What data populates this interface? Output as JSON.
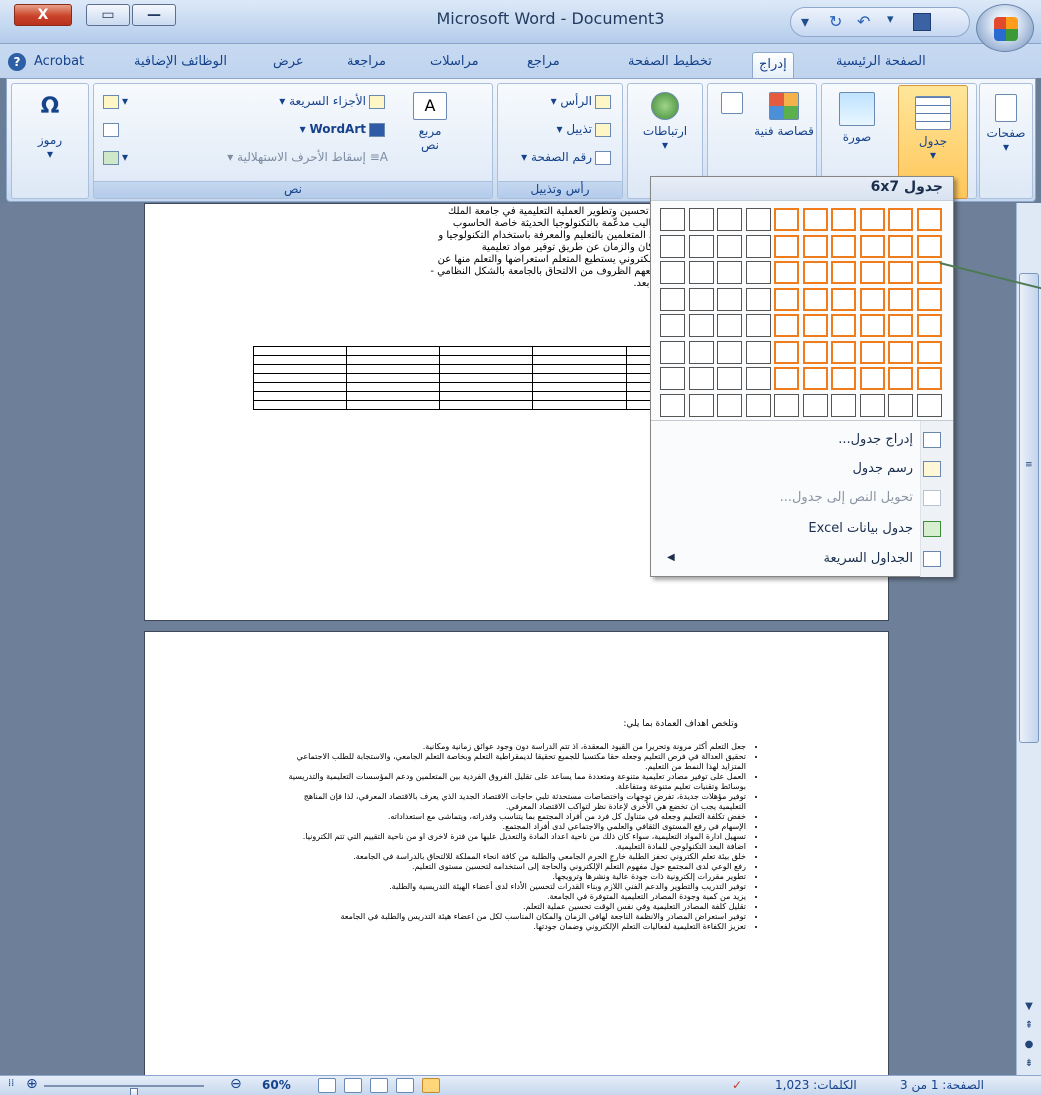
{
  "title_bar": {
    "title": "Microsoft Word - Document3",
    "close_label": "X",
    "restore_label": "▭",
    "minimize_label": "—",
    "qat_icons": [
      "save-icon",
      "redo-icon",
      "undo-icon",
      "customize-icon"
    ]
  },
  "tabs": {
    "help": "?",
    "items": [
      "Acrobat",
      "الوظائف الإضافية",
      "عرض",
      "مراجعة",
      "مراسلات",
      "مراجع",
      "تخطيط الصفحة",
      "إدراج",
      "الصفحة الرئيسية"
    ],
    "active": "إدراج"
  },
  "ribbon": {
    "pages": "صفحات",
    "table": "جدول",
    "picture": "صورة",
    "clipart": "قصاصة فنية",
    "links": "ارتباطات",
    "header": "الرأس",
    "footer": "تذييل",
    "page_number": "رقم الصفحة",
    "header_footer_group": "رأس وتذييل",
    "quick_parts": "الأجزاء السريعة",
    "wordart": "WordArt",
    "dropcap": "إسقاط الأحرف الاستهلالية",
    "textbox": "مربع نص",
    "text_group": "نص",
    "symbols": "رموز",
    "omega": "Ω"
  },
  "dropdown": {
    "header": "6x7 جدول",
    "grid_cols": 10,
    "grid_rows": 8,
    "hl_cols": 6,
    "hl_rows": 7,
    "items": [
      {
        "label": "إدراج جدول...",
        "disabled": false
      },
      {
        "label": "رسم جدول",
        "disabled": false
      },
      {
        "label": "تحويل النص إلى جدول...",
        "disabled": true
      },
      {
        "label": "جدول بيانات Excel",
        "disabled": false
      },
      {
        "label": "الجداول السريعة",
        "disabled": false
      }
    ]
  },
  "page1": {
    "lines": [
      "...كتروني الى تحسين وتطوير العملية التعليمية في جامعة الملك",
      "...تيجيات وأساليب مدعّمة بالتكنولوجيا الحديثة خاصة الحاسوب",
      "حيث يتم تزويد المتعلمين بالتعليم والمعرفة باستخدام التكنولوجيا و",
      "النظر عن المكان والزمان عن طريق توفير مواد تعليمية",
      "نظمة بشكل الكتروني يستطيع المتعلم استعراضها والتعلم منها عن",
      "لبة - الذين تمنعهم الظروف من الالتحاق بالجامعة بالشكل النظامي -",
      "لك فيصل عن بعد."
    ]
  },
  "page2": {
    "heading": "وتلخص اهداف العمادة بما يلي:",
    "bullets": [
      "جعل التعلم أكثر مرونة وتحريرا من القيود المعقدة، اذ تتم الدراسة دون وجود عوائق زمانية ومكانية.",
      "تحقيق العدالة في فرص التعليم وجعله حقا مكتسبا للجميع تحقيقا لديمقراطية التعلم وبخاصة التعلم الجامعي، والاستجابة للطلب الاجتماعي المتزايد لهذا النمط من التعليم.",
      "العمل على توفير مصادر تعليمية متنوعة ومتعددة مما يساعد على تقليل الفروق الفردية بين المتعلمين ودعم المؤسسات التعليمية والتدريسية بوسائط وتقنيات تعليم متنوعة ومتفاعلة.",
      "توفير مؤهلات جديدة، تفرض توجهات واختصاصات مستحدثة تلبي حاجات الاقتصاد الجديد الذي يعرف بالاقتصاد المعرفي، لذا فإن المناهج التعليمية يجب ان تخضع هي الأخرى لإعادة نظر لتواكب الاقتصاد المعرفي.",
      "خفض تكلفة التعليم وجعله في متناول كل فرد من أفراد المجتمع بما يتناسب وقدراته، ويتماشى مع استعداداته.",
      "الإسهام في رفع المستوى الثقافي والعلمي والاجتماعي لدى أفراد المجتمع.",
      "تسهيل ادارة المواد التعليمية، سواء كان ذلك من ناحية اعداد المادة والتعديل عليها من فترة لاخرى او من ناحية التقييم التي تتم الكترونيا.",
      "اضافة البعد التكنولوجي للمادة التعليمية.",
      "خلق بيئة تعلم الكتروني تحفز الطلبة خارج الحرم الجامعي والطلبة من كافة انحاء المملكة للالتحاق بالدراسة في الجامعة.",
      "رفع الوعي لدى المجتمع حول مفهوم التعلّم الإلكتروني والحاجة إلى استخدامه لتحسين مستوى التعليم.",
      "تطوير مقررات إلكترونية ذات جودة عالية ونشرها وترويجها.",
      "توفير التدريب والتطوير والدعم الفني اللازم وبناء القدرات لتحسين الأداء لدى أعضاء الهيئة التدريسية والطلبة.",
      "يزيد من كمية وجودة المصادر التعليمية المتوفرة في الجامعة.",
      "تقليل كلفة المصادر التعليمية وفي نفس الوقت تحسين عملية التعلم.",
      "توفير استعراض المصادر والانظمة الناجعة لهافي الزمان والمكان المناسب لكل من اعضاء هيئة التدريس والطلبة في الجامعة",
      "تعزيز الكفاءة التعليمية لفعاليات التعلم الإلكتروني وضمان جودتها."
    ]
  },
  "status": {
    "page": "الصفحة: 1 من 3",
    "words": "الكلمات: 1,023",
    "zoom": "60%",
    "zoom_level_pct": 60
  }
}
